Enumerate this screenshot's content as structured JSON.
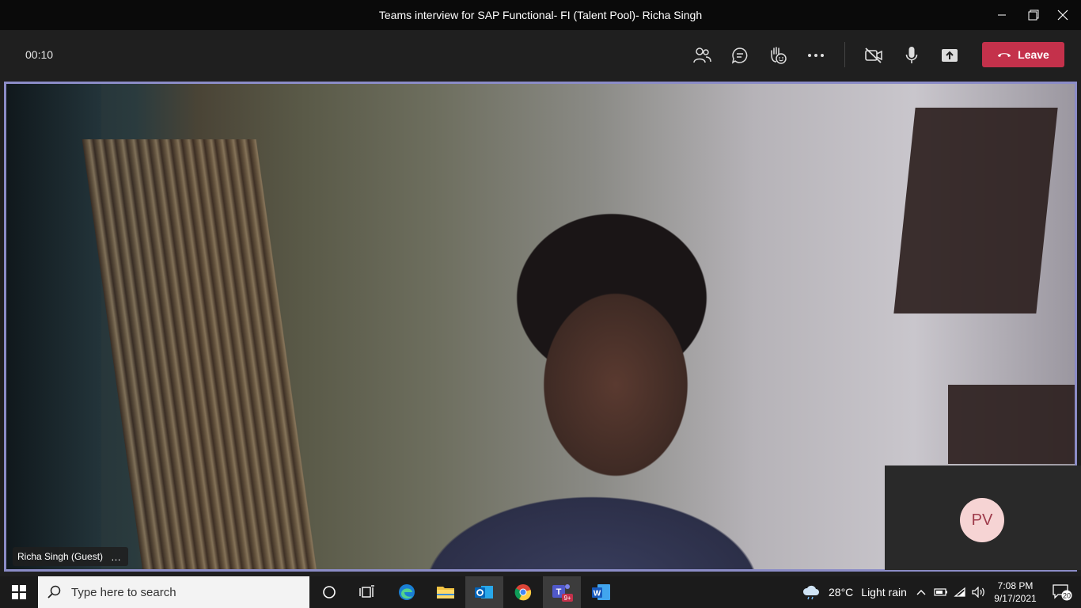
{
  "window": {
    "title": "Teams interview for SAP Functional- FI (Talent Pool)- Richa Singh"
  },
  "call": {
    "timer": "00:10",
    "leave_label": "Leave",
    "controls": [
      "participants-icon",
      "chat-icon",
      "reactions-icon",
      "more-icon",
      "camera-off-icon",
      "mic-icon",
      "share-icon"
    ]
  },
  "video": {
    "participant_name": "Richa Singh (Guest)",
    "more_options": "…"
  },
  "pip": {
    "initials": "PV"
  },
  "taskbar": {
    "search_placeholder": "Type here to search",
    "teams_badge": "9+",
    "weather": {
      "temp": "28°C",
      "condition": "Light rain"
    },
    "time": "7:08 PM",
    "date": "9/17/2021",
    "notification_count": "20"
  },
  "colors": {
    "leave": "#c4314b",
    "stage_border": "#8b8cc7",
    "avatar_bg": "#f6d4d4",
    "avatar_text": "#9e3b4b"
  }
}
